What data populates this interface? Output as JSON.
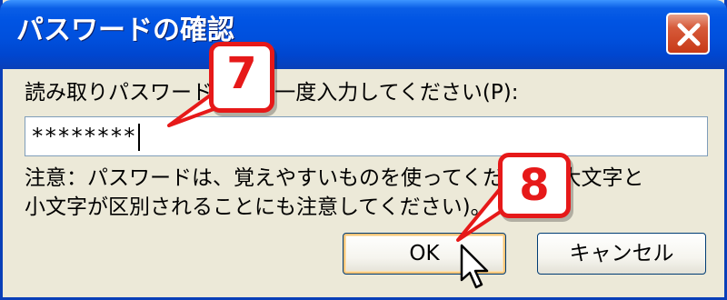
{
  "window": {
    "title": "パスワードの確認"
  },
  "prompt": {
    "label": "読み取りパスワードをもう一度入力してください(P):"
  },
  "password_field": {
    "value": "********"
  },
  "note": {
    "line1": "注意：パスワードは、覚えやすいものを使ってください (大文字と",
    "line2": "小文字が区別されることにも注意してください)。"
  },
  "buttons": {
    "ok_label": "OK",
    "cancel_label": "キャンセル"
  },
  "annotations": {
    "step_a": "7",
    "step_b": "8"
  },
  "colors": {
    "callout_red": "#E61919",
    "title_blue": "#0054E3",
    "dialog_bg": "#ECE9D8"
  }
}
